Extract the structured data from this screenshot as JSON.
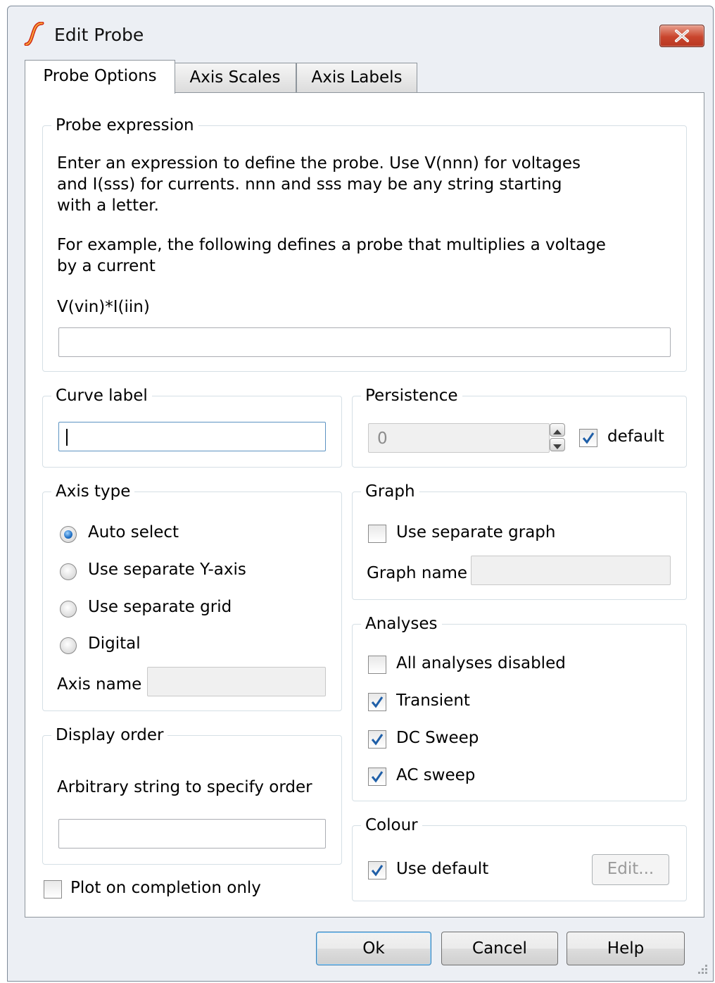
{
  "window": {
    "title": "Edit Probe",
    "app_icon": "simetrix-s-icon",
    "close_icon": "close-x-icon"
  },
  "tabs": [
    {
      "label": "Probe Options",
      "active": true
    },
    {
      "label": "Axis Scales",
      "active": false
    },
    {
      "label": "Axis Labels",
      "active": false
    }
  ],
  "probe_expression": {
    "legend": "Probe expression",
    "help_lines": [
      "Enter an expression to define the probe. Use V(nnn) for voltages",
      "and I(sss) for currents. nnn and sss may be any string starting",
      "with a letter."
    ],
    "example_lines": [
      "For example, the following defines a probe that multiplies a voltage",
      "by a current"
    ],
    "example": "V(vin)*I(iin)",
    "value": ""
  },
  "curve_label": {
    "legend": "Curve label",
    "value": ""
  },
  "persistence": {
    "legend": "Persistence",
    "value": "0",
    "default_label": "default",
    "default_checked": true
  },
  "axis_type": {
    "legend": "Axis type",
    "options": [
      {
        "label": "Auto select",
        "selected": true
      },
      {
        "label": "Use separate Y-axis",
        "selected": false
      },
      {
        "label": "Use separate grid",
        "selected": false
      },
      {
        "label": "Digital",
        "selected": false
      }
    ],
    "axis_name_label": "Axis name",
    "axis_name_value": ""
  },
  "graph": {
    "legend": "Graph",
    "separate_label": "Use separate graph",
    "separate_checked": false,
    "graph_name_label": "Graph name",
    "graph_name_value": ""
  },
  "display_order": {
    "legend": "Display order",
    "description": "Arbitrary string to specify order",
    "value": ""
  },
  "analyses": {
    "legend": "Analyses",
    "items": [
      {
        "label": "All analyses disabled",
        "checked": false
      },
      {
        "label": "Transient",
        "checked": true
      },
      {
        "label": "DC Sweep",
        "checked": true
      },
      {
        "label": "AC sweep",
        "checked": true
      }
    ]
  },
  "colour": {
    "legend": "Colour",
    "use_default_label": "Use default",
    "use_default_checked": true,
    "edit_label": "Edit..."
  },
  "plot_on_completion": {
    "label": "Plot on completion only",
    "checked": false
  },
  "buttons": {
    "ok": "Ok",
    "cancel": "Cancel",
    "help": "Help"
  },
  "colors": {
    "dialog_bg": "#eceff4",
    "close_red": "#c9452d",
    "check_blue": "#1f5fa8"
  }
}
